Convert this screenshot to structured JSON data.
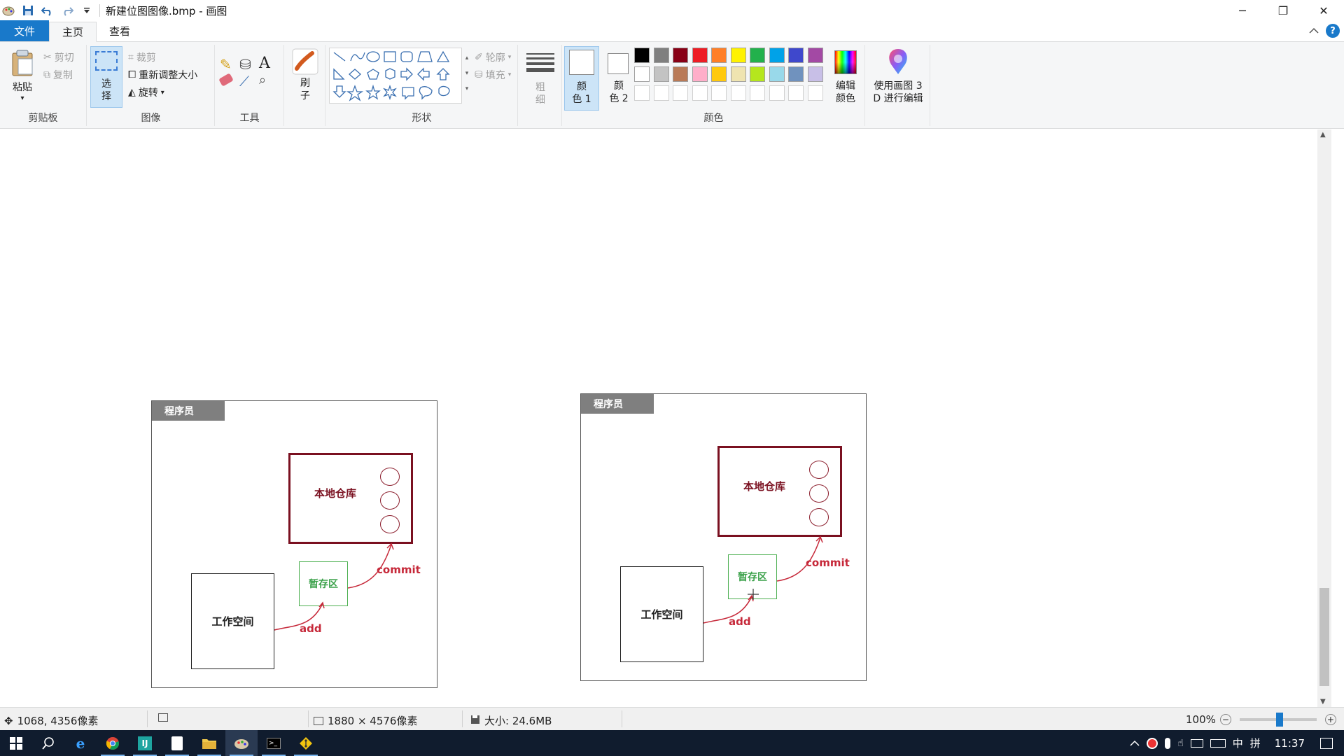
{
  "window": {
    "title": "新建位图图像.bmp - 画图",
    "controls": {
      "minimize": "─",
      "restore": "❐",
      "close": "✕"
    }
  },
  "tabs": [
    {
      "label": "文件"
    },
    {
      "label": "主页"
    },
    {
      "label": "查看"
    }
  ],
  "ribbon": {
    "clipboard": {
      "paste": "粘贴",
      "cut": "剪切",
      "copy": "复制",
      "group": "剪贴板"
    },
    "image": {
      "select_top": "选",
      "select_bottom": "择",
      "crop": "裁剪",
      "resize": "重新调整大小",
      "rotate": "旋转",
      "group": "图像"
    },
    "tools": {
      "group": "工具"
    },
    "brushes": {
      "label_top": "刷",
      "label_bottom": "子"
    },
    "shapes": {
      "outline": "轮廓",
      "fill": "填充",
      "group": "形状"
    },
    "size": {
      "label_top": "粗",
      "label_bottom": "细"
    },
    "colors": {
      "color1_top": "颜",
      "color1_bottom": "色 1",
      "color2_top": "颜",
      "color2_bottom": "色 2",
      "edit_top": "编辑",
      "edit_bottom": "颜色",
      "group": "颜色",
      "palette_row1": [
        "#000000",
        "#7f7f7f",
        "#880015",
        "#ed1c24",
        "#ff7f27",
        "#fff200",
        "#22b14c",
        "#00a2e8",
        "#3f48cc",
        "#a349a4"
      ],
      "palette_row2": [
        "#ffffff",
        "#c3c3c3",
        "#b97a57",
        "#ffaec9",
        "#ffc90e",
        "#efe4b0",
        "#b5e61d",
        "#99d9ea",
        "#7092be",
        "#c8bfe7"
      ]
    },
    "paint3d": {
      "line1": "使用画图 3",
      "line2": "D 进行编辑"
    }
  },
  "diagrams": [
    {
      "header": "程序员",
      "local_repo": "本地仓库",
      "staging": "暂存区",
      "workspace": "工作空间",
      "add": "add",
      "commit": "commit"
    },
    {
      "header": "程序员",
      "local_repo": "本地仓库",
      "staging": "暂存区",
      "workspace": "工作空间",
      "add": "add",
      "commit": "commit"
    }
  ],
  "status": {
    "cursor_pos": "1068, 4356像素",
    "image_dims": "1880 × 4576像素",
    "file_size": "大小: 24.6MB",
    "zoom": "100%"
  },
  "taskbar": {
    "time": "11:37",
    "ime": "中",
    "ime2": "拼"
  }
}
